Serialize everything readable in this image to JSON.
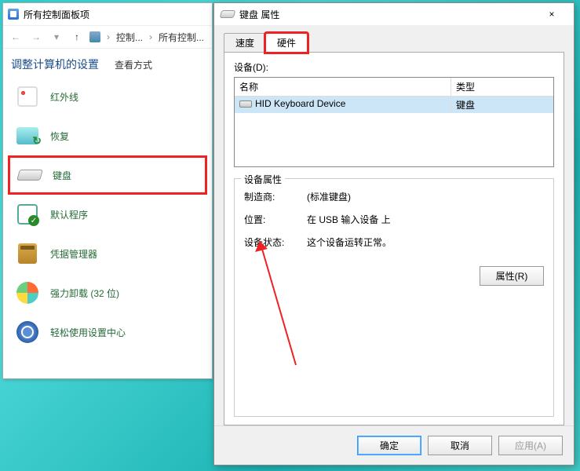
{
  "control_panel": {
    "window_title": "所有控制面板项",
    "breadcrumb": {
      "seg1": "控制...",
      "seg2": "所有控制..."
    },
    "heading": "调整计算机的设置",
    "view_label": "查看方式",
    "items": [
      {
        "label": "红外线"
      },
      {
        "label": "恢复"
      },
      {
        "label": "键盘"
      },
      {
        "label": "默认程序"
      },
      {
        "label": "凭据管理器"
      },
      {
        "label": "强力卸载 (32 位)"
      },
      {
        "label": "轻松使用设置中心"
      }
    ]
  },
  "dialog": {
    "title": "键盘 属性",
    "close": "×",
    "tabs": {
      "speed": "速度",
      "hardware": "硬件"
    },
    "devices_label": "设备(D):",
    "columns": {
      "name": "名称",
      "type": "类型"
    },
    "device_row": {
      "name": "HID Keyboard Device",
      "type": "键盘"
    },
    "group_title": "设备属性",
    "props": {
      "mfr_label": "制造商:",
      "mfr_value": "(标准键盘)",
      "loc_label": "位置:",
      "loc_value": "在 USB 输入设备 上",
      "stat_label": "设备状态:",
      "stat_value": "这个设备运转正常。"
    },
    "buttons": {
      "properties": "属性(R)",
      "ok": "确定",
      "cancel": "取消",
      "apply": "应用(A)"
    }
  }
}
